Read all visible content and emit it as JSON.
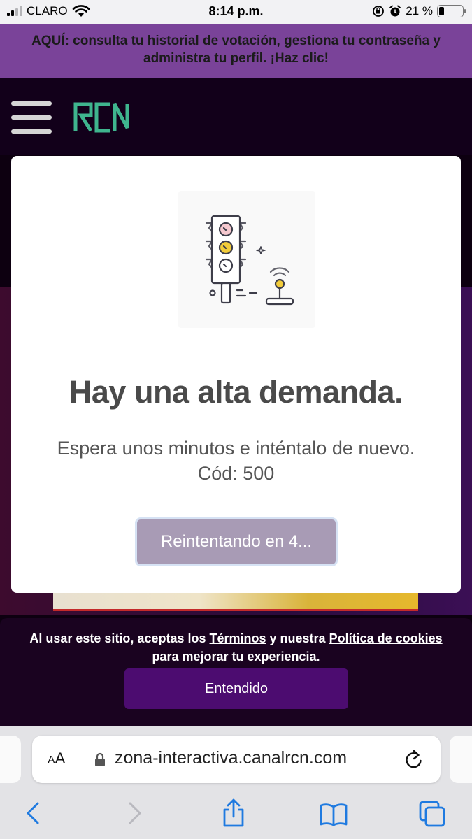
{
  "status_bar": {
    "carrier": "CLARO",
    "time": "8:14 p.m.",
    "battery": "21 %",
    "battery_level": 0.21
  },
  "banner": {
    "text": "AQUÍ: consulta tu historial de votación, gestiona tu contraseña y administra tu perfil. ¡Haz clic!"
  },
  "header": {
    "logo": "RCN"
  },
  "modal": {
    "title": "Hay una alta demanda.",
    "message_line1": "Espera unos minutos e inténtalo de nuevo.",
    "message_line2": "Cód: 500",
    "retry_button": "Reintentando en 4...",
    "retry_button_color": "#a89bb5"
  },
  "cookie_bar": {
    "text_before": "Al usar este sitio, aceptas los ",
    "terms_link": "Términos",
    "text_middle": " y nuestra ",
    "cookies_link": "Política de cookies",
    "text_after": " para mejorar tu experiencia.",
    "button": "Entendido",
    "button_color": "#4c0c70"
  },
  "browser": {
    "aa_small": "A",
    "aa_large": "A",
    "url": "zona-interactiva.canalrcn.com"
  },
  "colors": {
    "banner_bg": "#7a4399",
    "accent": "#4c0c70",
    "logo_green": "#3fb58e",
    "ios_blue": "#1f7ae0"
  }
}
